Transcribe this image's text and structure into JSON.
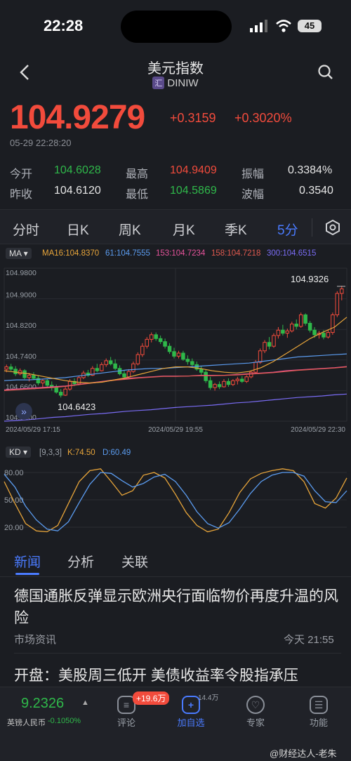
{
  "status_bar": {
    "time": "22:28",
    "battery": "45"
  },
  "header": {
    "title": "美元指数",
    "badge": "汇",
    "code": "DINIW"
  },
  "quote": {
    "price": "104.9279",
    "change": "+0.3159",
    "change_pct": "+0.3020%",
    "timestamp": "05-29 22:28:20",
    "stats": [
      {
        "label": "今开",
        "value": "104.6028",
        "tone": "green"
      },
      {
        "label": "最高",
        "value": "104.9409",
        "tone": "red"
      },
      {
        "label": "振幅",
        "value": "0.3384%",
        "tone": "white"
      },
      {
        "label": "昨收",
        "value": "104.6120",
        "tone": "white"
      },
      {
        "label": "最低",
        "value": "104.5869",
        "tone": "green"
      },
      {
        "label": "波幅",
        "value": "0.3540",
        "tone": "white"
      }
    ]
  },
  "period_tabs": [
    "分时",
    "日K",
    "周K",
    "月K",
    "季K",
    "5分"
  ],
  "active_period": "5分",
  "ma_legend": {
    "selector": "MA",
    "items": [
      {
        "text": "MA16:104.8370",
        "color": "#e8a53a"
      },
      {
        "text": "61:104.7555",
        "color": "#5b9cf0"
      },
      {
        "text": "153:104.7234",
        "color": "#e5539a"
      },
      {
        "text": "158:104.7218",
        "color": "#e05a4f"
      },
      {
        "text": "300:104.6515",
        "color": "#7a6cf5"
      }
    ]
  },
  "chart_data": [
    {
      "type": "candlestick",
      "y_ticks": [
        "104.9800",
        "104.9000",
        "104.8200",
        "104.7400",
        "104.6600",
        "104.5800"
      ],
      "ylim": [
        104.58,
        104.98
      ],
      "x_ticks": [
        "2024/05/29 17:15",
        "2024/05/29 19:55",
        "2024/05/29 22:30"
      ],
      "annotations": {
        "high_label": "104.9326",
        "low_label": "104.6423"
      },
      "candles_ohlc": [
        [
          104.716,
          104.728,
          104.708,
          104.722
        ],
        [
          104.722,
          104.73,
          104.712,
          104.716
        ],
        [
          104.716,
          104.724,
          104.698,
          104.704
        ],
        [
          104.704,
          104.718,
          104.7,
          104.712
        ],
        [
          104.712,
          104.716,
          104.69,
          104.694
        ],
        [
          104.694,
          104.706,
          104.684,
          104.7
        ],
        [
          104.7,
          104.708,
          104.688,
          104.692
        ],
        [
          104.692,
          104.7,
          104.674,
          104.68
        ],
        [
          104.68,
          104.69,
          104.668,
          104.686
        ],
        [
          104.686,
          104.692,
          104.67,
          104.674
        ],
        [
          104.674,
          104.684,
          104.66,
          104.668
        ],
        [
          104.668,
          104.676,
          104.652,
          104.656
        ],
        [
          104.656,
          104.664,
          104.642,
          104.648
        ],
        [
          104.648,
          104.67,
          104.646,
          104.664
        ],
        [
          104.664,
          104.69,
          104.66,
          104.684
        ],
        [
          104.684,
          104.692,
          104.672,
          104.678
        ],
        [
          104.678,
          104.698,
          104.674,
          104.694
        ],
        [
          104.694,
          104.712,
          104.69,
          104.706
        ],
        [
          104.706,
          104.714,
          104.696,
          104.7
        ],
        [
          104.7,
          104.724,
          104.698,
          104.718
        ],
        [
          104.718,
          104.73,
          104.708,
          104.712
        ],
        [
          104.712,
          104.734,
          104.71,
          104.728
        ],
        [
          104.728,
          104.744,
          104.722,
          104.738
        ],
        [
          104.738,
          104.748,
          104.726,
          104.73
        ],
        [
          104.73,
          104.742,
          104.714,
          104.718
        ],
        [
          104.718,
          104.726,
          104.7,
          104.704
        ],
        [
          104.704,
          104.714,
          104.688,
          104.696
        ],
        [
          104.696,
          104.716,
          104.692,
          104.71
        ],
        [
          104.71,
          104.736,
          104.706,
          104.73
        ],
        [
          104.73,
          104.76,
          104.726,
          104.754
        ],
        [
          104.754,
          104.784,
          104.748,
          104.776
        ],
        [
          104.776,
          104.8,
          104.77,
          104.794
        ],
        [
          104.794,
          104.812,
          104.786,
          104.806
        ],
        [
          104.806,
          104.812,
          104.79,
          104.796
        ],
        [
          104.796,
          104.804,
          104.782,
          104.788
        ],
        [
          104.788,
          104.796,
          104.77,
          104.776
        ],
        [
          104.776,
          104.784,
          104.756,
          104.762
        ],
        [
          104.762,
          104.772,
          104.744,
          104.75
        ],
        [
          104.75,
          104.764,
          104.744,
          104.758
        ],
        [
          104.758,
          104.764,
          104.738,
          104.742
        ],
        [
          104.742,
          104.752,
          104.728,
          104.736
        ],
        [
          104.736,
          104.744,
          104.722,
          104.728
        ],
        [
          104.728,
          104.736,
          104.712,
          104.716
        ],
        [
          104.716,
          104.724,
          104.7,
          104.708
        ],
        [
          104.708,
          104.714,
          104.68,
          104.686
        ],
        [
          104.686,
          104.696,
          104.662,
          104.668
        ],
        [
          104.668,
          104.68,
          104.66,
          104.676
        ],
        [
          104.676,
          104.684,
          104.664,
          104.67
        ],
        [
          104.67,
          104.69,
          104.668,
          104.684
        ],
        [
          104.684,
          104.692,
          104.67,
          104.676
        ],
        [
          104.676,
          104.69,
          104.672,
          104.686
        ],
        [
          104.686,
          104.696,
          104.676,
          104.69
        ],
        [
          104.69,
          104.698,
          104.68,
          104.684
        ],
        [
          104.684,
          104.7,
          104.68,
          104.696
        ],
        [
          104.696,
          104.712,
          104.692,
          104.708
        ],
        [
          104.708,
          104.74,
          104.704,
          104.734
        ],
        [
          104.734,
          104.77,
          104.73,
          104.764
        ],
        [
          104.764,
          104.792,
          104.758,
          104.786
        ],
        [
          104.786,
          104.8,
          104.768,
          104.776
        ],
        [
          104.776,
          104.81,
          104.772,
          104.804
        ],
        [
          104.804,
          104.826,
          104.796,
          104.818
        ],
        [
          104.818,
          104.832,
          104.804,
          104.81
        ],
        [
          104.81,
          104.822,
          104.798,
          104.816
        ],
        [
          104.816,
          104.84,
          104.812,
          104.834
        ],
        [
          104.834,
          104.846,
          104.82,
          104.828
        ],
        [
          104.828,
          104.864,
          104.824,
          104.858
        ],
        [
          104.858,
          104.862,
          104.83,
          104.836
        ],
        [
          104.836,
          104.842,
          104.812,
          104.818
        ],
        [
          104.818,
          104.826,
          104.798,
          104.806
        ],
        [
          104.806,
          104.816,
          104.796,
          104.81
        ],
        [
          104.81,
          104.818,
          104.794,
          104.8
        ],
        [
          104.8,
          104.818,
          104.796,
          104.812
        ],
        [
          104.812,
          104.864,
          104.806,
          104.858
        ],
        [
          104.858,
          104.92,
          104.852,
          104.914
        ],
        [
          104.914,
          104.934,
          104.896,
          104.926
        ]
      ],
      "ma_series": {
        "MA16": [
          104.712,
          104.708,
          104.704,
          104.698,
          104.692,
          104.686,
          104.682,
          104.68,
          104.682,
          104.688,
          104.694,
          104.702,
          104.71,
          104.718,
          104.722,
          104.722,
          104.718,
          104.712,
          104.708,
          104.706,
          104.71,
          104.72,
          104.736,
          104.756,
          104.776,
          104.796,
          104.812,
          104.826,
          104.852
        ],
        "61": [
          104.686,
          104.688,
          104.688,
          104.69,
          104.692,
          104.694,
          104.698,
          104.702,
          104.706,
          104.71,
          104.714,
          104.716,
          104.718,
          104.718,
          104.72,
          104.722,
          104.724,
          104.726,
          104.728,
          104.73,
          104.732,
          104.736,
          104.74,
          104.744,
          104.748,
          104.75,
          104.752,
          104.754,
          104.756
        ],
        "153": [
          104.662,
          104.664,
          104.666,
          104.668,
          104.67,
          104.672,
          104.676,
          104.68,
          104.684,
          104.688,
          104.692,
          104.694,
          104.696,
          104.698,
          104.698,
          104.698,
          104.7,
          104.7,
          104.7,
          104.702,
          104.704,
          104.706,
          104.708,
          104.712,
          104.714,
          104.716,
          104.718,
          104.72,
          104.723
        ],
        "158": [
          104.66,
          104.662,
          104.664,
          104.666,
          104.668,
          104.671,
          104.675,
          104.679,
          104.683,
          104.687,
          104.69,
          104.693,
          104.695,
          104.697,
          104.697,
          104.698,
          104.699,
          104.699,
          104.7,
          104.701,
          104.703,
          104.705,
          104.707,
          104.71,
          104.713,
          104.715,
          104.717,
          104.719,
          104.722
        ],
        "300": [
          104.58,
          104.582,
          104.584,
          104.587,
          104.59,
          104.592,
          104.595,
          104.598,
          104.6,
          104.603,
          104.606,
          104.608,
          104.61,
          104.613,
          104.616,
          104.618,
          104.62,
          104.622,
          104.625,
          104.628,
          104.63,
          104.633,
          104.636,
          104.639,
          104.642,
          104.644,
          104.646,
          104.649,
          104.651
        ]
      }
    },
    {
      "type": "line",
      "selector": "KD",
      "params": "[9,3,3]",
      "k_label": "K:74.50",
      "d_label": "D:60.49",
      "y_ticks": [
        "80.00",
        "50.00",
        "20.00"
      ],
      "ylim": [
        10,
        90
      ],
      "series": [
        {
          "name": "K",
          "color": "#e8a53a",
          "values": [
            70,
            46,
            24,
            16,
            15,
            22,
            46,
            70,
            82,
            84,
            70,
            55,
            60,
            77,
            80,
            74,
            56,
            36,
            22,
            15,
            18,
            36,
            58,
            73,
            79,
            82,
            84,
            82,
            70,
            46,
            41,
            52,
            74
          ]
        },
        {
          "name": "D",
          "color": "#5b9cf0",
          "values": [
            78,
            64,
            43,
            28,
            18,
            16,
            26,
            47,
            67,
            80,
            79,
            71,
            64,
            68,
            75,
            78,
            70,
            55,
            37,
            24,
            19,
            25,
            40,
            57,
            70,
            77,
            80,
            80,
            76,
            60,
            48,
            47,
            60
          ]
        }
      ]
    }
  ],
  "sub_tabs": [
    "新闻",
    "分析",
    "关联"
  ],
  "news": [
    {
      "title": "德国通胀反弹显示欧洲央行面临物价再度升温的风险",
      "source": "市场资讯",
      "time": "今天 21:55"
    },
    {
      "title": "开盘：美股周三低开 美债收益率令股指承压"
    }
  ],
  "bottom_bar": {
    "ticker_price": "9.2326",
    "ticker_name": "英镑人民币",
    "ticker_change": "-0.1050%",
    "comment_label": "评论",
    "comment_badge": "+19.6万",
    "watch_label": "加自选",
    "watch_count": "14.4万",
    "expert_label": "专家",
    "func_label": "功能"
  },
  "watermark": "@财经达人-老朱"
}
